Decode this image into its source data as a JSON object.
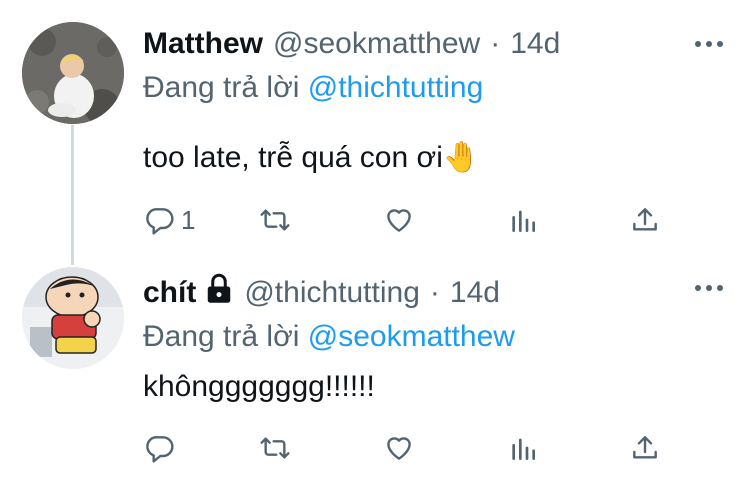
{
  "tweets": [
    {
      "author_name": "Matthew",
      "handle": "@seokmatthew",
      "separator": "·",
      "time": "14d",
      "reply_prefix": "Đang trả lời",
      "reply_to": "@thichtutting",
      "text": "too late, trễ quá con ơi🤚",
      "reply_count": "1",
      "retweet_count": "",
      "like_count": "",
      "protected": false
    },
    {
      "author_name": "chít",
      "handle": "@thichtutting",
      "separator": "·",
      "time": "14d",
      "reply_prefix": "Đang trả lời",
      "reply_to": "@seokmatthew",
      "text": "khônggggggg!!!!!!",
      "reply_count": "",
      "retweet_count": "",
      "like_count": "",
      "protected": true
    }
  ],
  "icons": {
    "more": "more-icon",
    "reply": "reply-icon",
    "retweet": "retweet-icon",
    "like": "like-icon",
    "views": "views-icon",
    "share": "share-icon",
    "lock": "lock-icon"
  },
  "colors": {
    "text": "#0f1419",
    "muted": "#536471",
    "link": "#1d9bf0",
    "thread_line": "#cfd9de"
  }
}
